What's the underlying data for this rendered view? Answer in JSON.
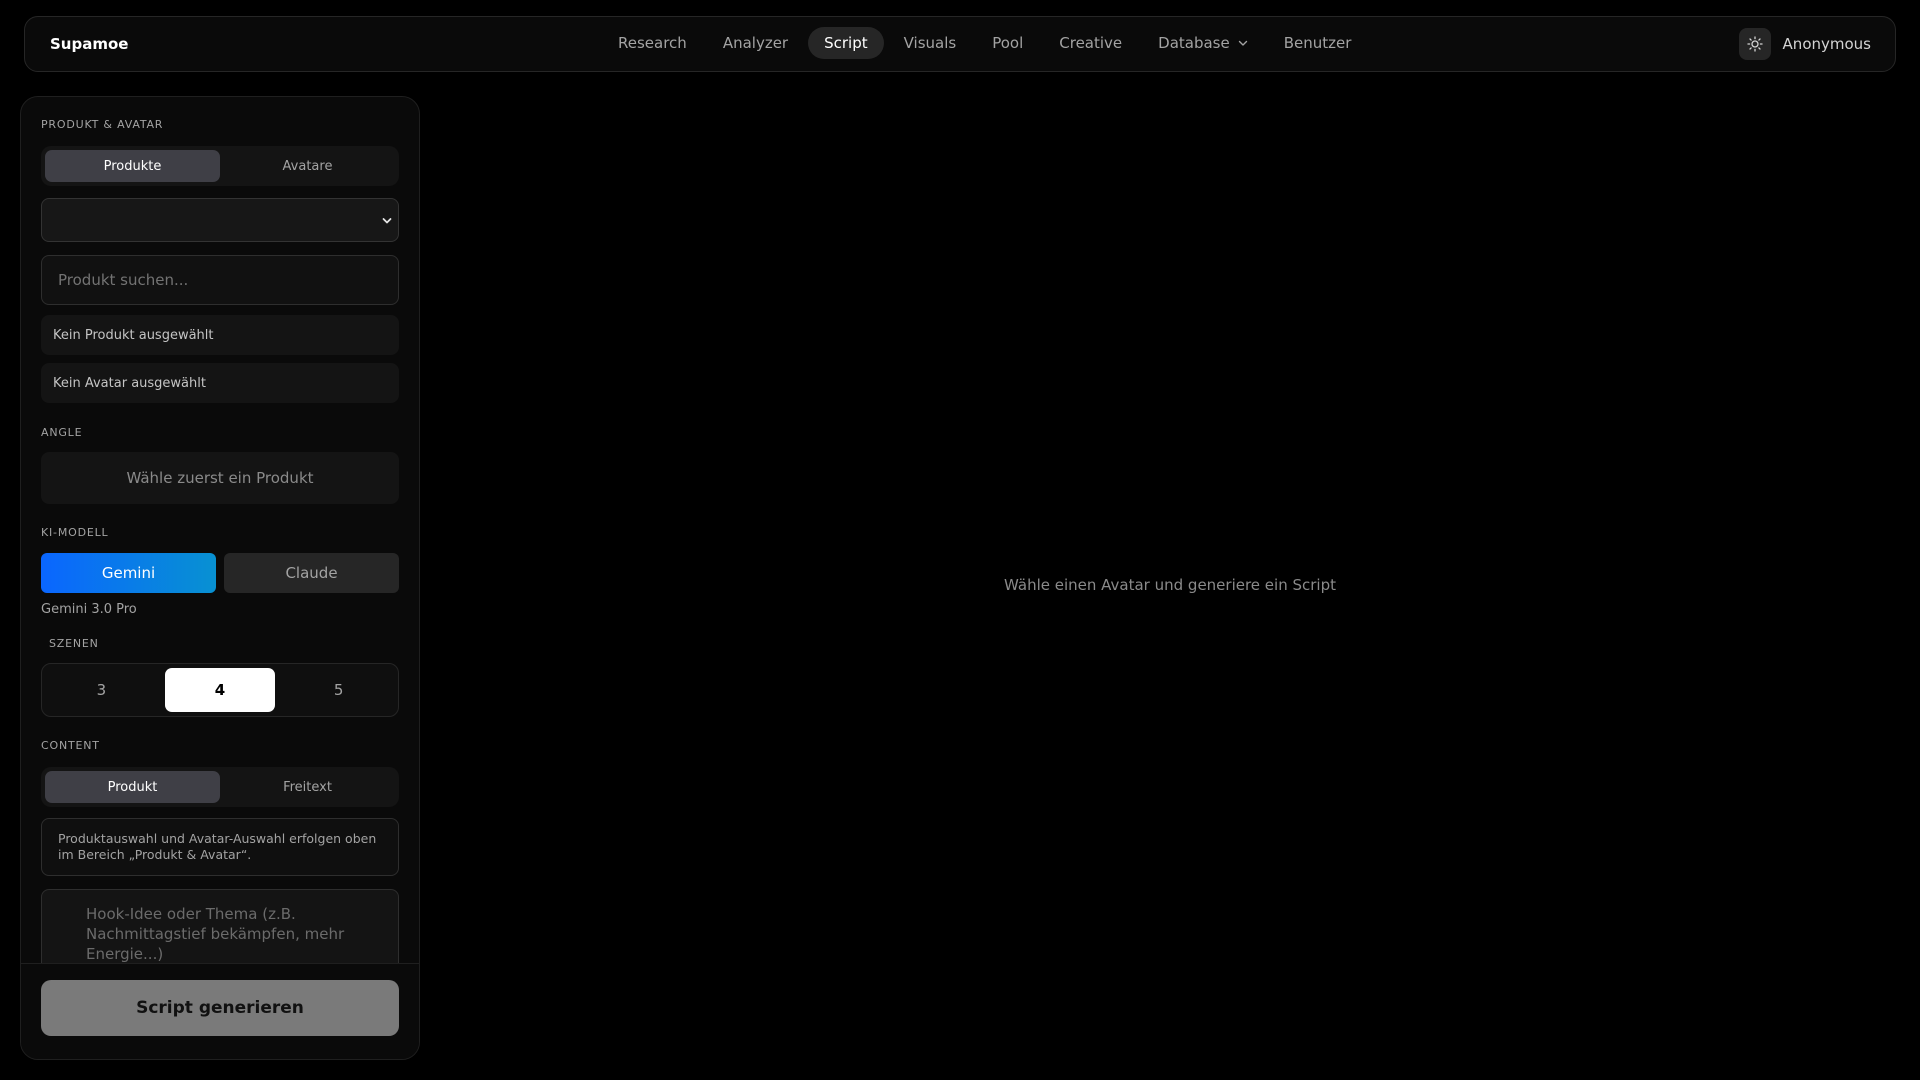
{
  "header": {
    "brand": "Supamoe",
    "nav": [
      "Research",
      "Analyzer",
      "Script",
      "Visuals",
      "Pool",
      "Creative",
      "Database",
      "Benutzer"
    ],
    "active_nav": "Script",
    "user": "Anonymous"
  },
  "sidebar": {
    "produkt_avatar": {
      "label": "PRODUKT & AVATAR",
      "tabs": [
        "Produkte",
        "Avatare"
      ],
      "active_tab": "Produkte",
      "select_value": "",
      "search_placeholder": "Produkt suchen...",
      "no_product": "Kein Produkt ausgewählt",
      "no_avatar": "Kein Avatar ausgewählt"
    },
    "angle": {
      "label": "ANGLE",
      "placeholder": "Wähle zuerst ein Produkt"
    },
    "model": {
      "label": "KI-MODELL",
      "options": [
        "Gemini",
        "Claude"
      ],
      "selected": "Gemini",
      "subtitle": "Gemini 3.0 Pro"
    },
    "scenes": {
      "label": "SZENEN",
      "options": [
        "3",
        "4",
        "5"
      ],
      "selected": "4"
    },
    "content": {
      "label": "CONTENT",
      "tabs": [
        "Produkt",
        "Freitext"
      ],
      "active_tab": "Produkt",
      "note": "Produktauswahl und Avatar-Auswahl erfolgen oben im Bereich „Produkt & Avatar“.",
      "hook_placeholder": "Hook-Idee oder Thema (z.B. Nachmittagstief bekämpfen, mehr Energie...)"
    },
    "generate_button": "Script generieren"
  },
  "main": {
    "empty_message": "Wähle einen Avatar und generiere ein Script"
  },
  "colors": {
    "background": "#000000",
    "accent_gradient_start": "#0a66ff",
    "accent_gradient_end": "#0891d2"
  }
}
